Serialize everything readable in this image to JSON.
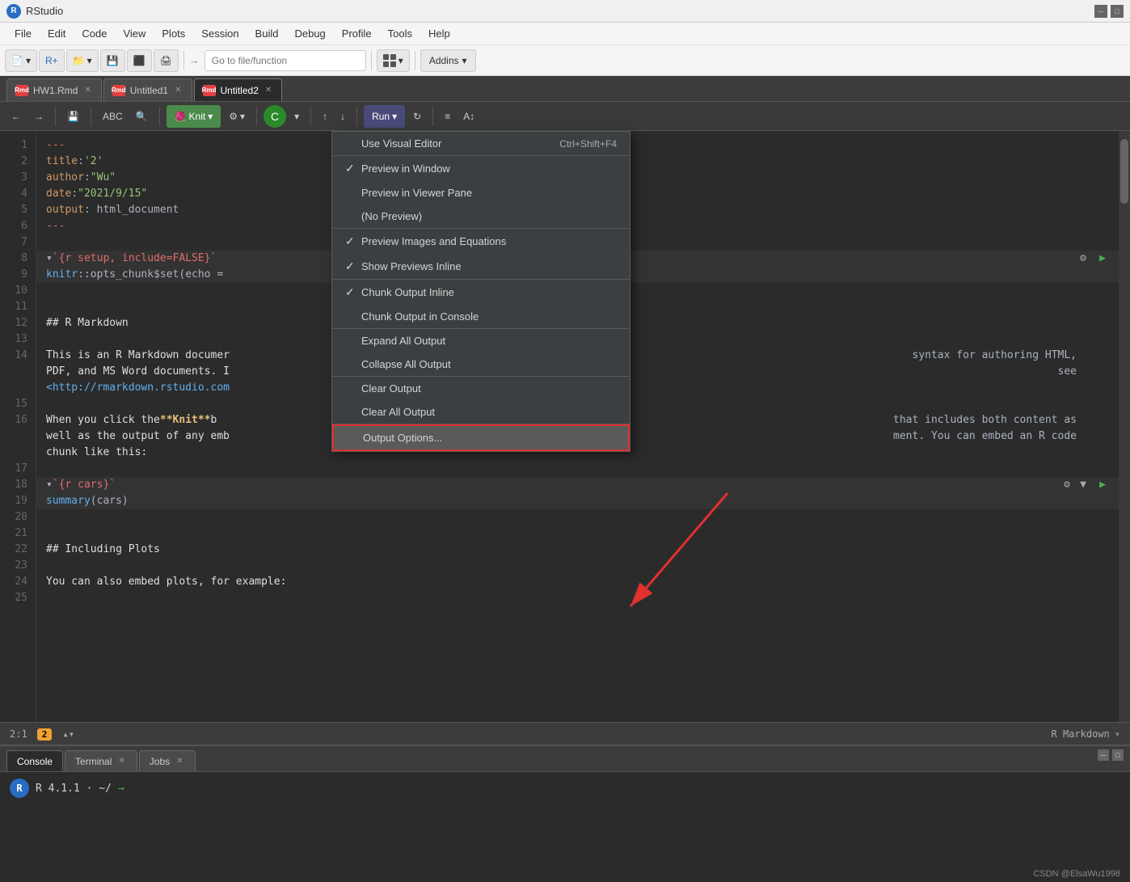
{
  "window": {
    "title": "RStudio"
  },
  "menubar": {
    "items": [
      "File",
      "Edit",
      "Code",
      "View",
      "Plots",
      "Session",
      "Build",
      "Debug",
      "Profile",
      "Tools",
      "Help"
    ]
  },
  "toolbar": {
    "goto_placeholder": "Go to file/function",
    "addins_label": "Addins"
  },
  "tabs": [
    {
      "label": "HW1.Rmd",
      "active": false
    },
    {
      "label": "Untitled1",
      "active": false
    },
    {
      "label": "Untitled2",
      "active": true
    }
  ],
  "editor_toolbar": {
    "back_label": "←",
    "forward_label": "→",
    "save_label": "💾",
    "abc_label": "ABC",
    "search_label": "🔍",
    "knit_label": "Knit",
    "settings_label": "⚙",
    "c_label": "C",
    "up_label": "↑",
    "down_label": "↓",
    "run_label": "Run",
    "rerun_label": "↻",
    "lines_label": "≡"
  },
  "code_lines": [
    {
      "num": "1",
      "content": "---",
      "type": "red"
    },
    {
      "num": "2",
      "content": "title: '2'",
      "type": "normal"
    },
    {
      "num": "3",
      "content": "author: \"Wu\"",
      "type": "normal"
    },
    {
      "num": "4",
      "content": "date: \"2021/9/15\"",
      "type": "normal"
    },
    {
      "num": "5",
      "content": "output: html_document",
      "type": "normal"
    },
    {
      "num": "6",
      "content": "---",
      "type": "red"
    },
    {
      "num": "7",
      "content": "",
      "type": "normal"
    },
    {
      "num": "8",
      "content": "{r setup, include=FALSE}",
      "type": "chunk"
    },
    {
      "num": "9",
      "content": "knitr::opts_chunk$set(echo =",
      "type": "chunk"
    },
    {
      "num": "10",
      "content": "",
      "type": "normal"
    },
    {
      "num": "11",
      "content": "",
      "type": "normal"
    },
    {
      "num": "12",
      "content": "## R Markdown",
      "type": "heading"
    },
    {
      "num": "13",
      "content": "",
      "type": "normal"
    },
    {
      "num": "14",
      "content": "This is an R Markdown documer",
      "type": "normal"
    },
    {
      "num": "",
      "content": "PDF, and MS Word documents. I",
      "type": "normal"
    },
    {
      "num": "",
      "content": "<http://rmarkdown.rstudio.com",
      "type": "link"
    },
    {
      "num": "15",
      "content": "",
      "type": "normal"
    },
    {
      "num": "16",
      "content": "When you click the **Knit** b",
      "type": "normal"
    },
    {
      "num": "",
      "content": "well as the output of any emb",
      "type": "normal"
    },
    {
      "num": "",
      "content": "chunk like this:",
      "type": "normal"
    },
    {
      "num": "17",
      "content": "",
      "type": "normal"
    },
    {
      "num": "18",
      "content": "{r cars}",
      "type": "chunk"
    },
    {
      "num": "19",
      "content": "summary(cars)",
      "type": "chunk_code"
    },
    {
      "num": "20",
      "content": "",
      "type": "normal"
    },
    {
      "num": "21",
      "content": "",
      "type": "normal"
    },
    {
      "num": "22",
      "content": "## Including Plots",
      "type": "heading"
    },
    {
      "num": "23",
      "content": "",
      "type": "normal"
    },
    {
      "num": "24",
      "content": "You can also embed plots, fo",
      "type": "normal"
    },
    {
      "num": "25",
      "content": "",
      "type": "normal"
    }
  ],
  "dropdown_menu": {
    "items": [
      {
        "section": 1,
        "label": "Use Visual Editor",
        "shortcut": "Ctrl+Shift+F4",
        "checked": false,
        "highlighted": false
      },
      {
        "section": 2,
        "label": "Preview in Window",
        "shortcut": "",
        "checked": true,
        "highlighted": false
      },
      {
        "section": 2,
        "label": "Preview in Viewer Pane",
        "shortcut": "",
        "checked": false,
        "highlighted": false
      },
      {
        "section": 2,
        "label": "(No Preview)",
        "shortcut": "",
        "checked": false,
        "highlighted": false
      },
      {
        "section": 3,
        "label": "Preview Images and Equations",
        "shortcut": "",
        "checked": true,
        "highlighted": false
      },
      {
        "section": 3,
        "label": "Show Previews Inline",
        "shortcut": "",
        "checked": true,
        "highlighted": false
      },
      {
        "section": 4,
        "label": "Chunk Output Inline",
        "shortcut": "",
        "checked": true,
        "highlighted": false
      },
      {
        "section": 4,
        "label": "Chunk Output in Console",
        "shortcut": "",
        "checked": false,
        "highlighted": false
      },
      {
        "section": 5,
        "label": "Expand All Output",
        "shortcut": "",
        "checked": false,
        "highlighted": false
      },
      {
        "section": 5,
        "label": "Collapse All Output",
        "shortcut": "",
        "checked": false,
        "highlighted": false
      },
      {
        "section": 6,
        "label": "Clear Output",
        "shortcut": "",
        "checked": false,
        "highlighted": false
      },
      {
        "section": 6,
        "label": "Clear All Output",
        "shortcut": "",
        "checked": false,
        "highlighted": false
      },
      {
        "section": 7,
        "label": "Output Options...",
        "shortcut": "",
        "checked": false,
        "highlighted": true
      }
    ]
  },
  "status_bar": {
    "position": "2:1",
    "badge": "2",
    "language": "R Markdown"
  },
  "bottom_tabs": [
    {
      "label": "Console",
      "active": true
    },
    {
      "label": "Terminal",
      "active": false
    },
    {
      "label": "Jobs",
      "active": false
    }
  ],
  "console": {
    "version": "R 4.1.1",
    "path": "~/",
    "icon_label": "R"
  },
  "bottom_right_label": "CSDN @ElsaWu1998"
}
